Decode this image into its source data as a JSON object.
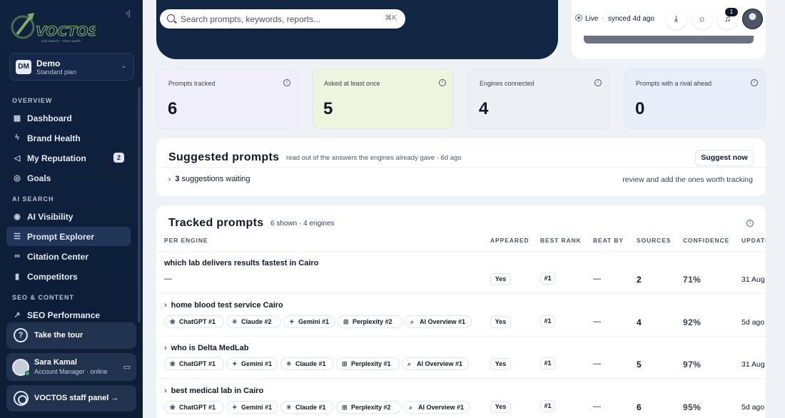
{
  "brand": {
    "name": "VOCTOS",
    "tagline": "one search · more worth"
  },
  "workspace": {
    "initials": "DM",
    "name": "Demo",
    "plan": "Standard plan"
  },
  "sidebar": {
    "sections": {
      "overview": "OVERVIEW",
      "ai_search": "AI SEARCH",
      "seo": "SEO & CONTENT"
    },
    "items": [
      {
        "label": "Dashboard",
        "icon": "grid-icon"
      },
      {
        "label": "Brand Health",
        "icon": "pulse-icon"
      },
      {
        "label": "My Reputation",
        "icon": "megaphone-icon",
        "badge": "2"
      },
      {
        "label": "Goals",
        "icon": "target-icon"
      },
      {
        "label": "AI Visibility",
        "icon": "eye-icon"
      },
      {
        "label": "Prompt Explorer",
        "icon": "list-icon",
        "active": true
      },
      {
        "label": "Citation Center",
        "icon": "link-icon"
      },
      {
        "label": "Competitors",
        "icon": "bar-chart-icon"
      },
      {
        "label": "SEO Performance",
        "icon": "trend-icon"
      }
    ],
    "tour_label": "Take the tour",
    "user": {
      "name": "Sara Kamal",
      "role": "Account Manager · online"
    },
    "staff_label": "VOCTOS staff panel →"
  },
  "topbar": {
    "search_placeholder": "Search prompts, keywords, reports...",
    "search_kbd": "⌘K",
    "live_label": "Live",
    "synced_label": "synced 4d ago",
    "notif_count": "1"
  },
  "stats": [
    {
      "label": "Prompts tracked",
      "value": "6",
      "bg": "#f1eefc"
    },
    {
      "label": "Asked at least once",
      "value": "5",
      "bg": "#eef5df"
    },
    {
      "label": "Engines connected",
      "value": "4",
      "bg": "#eceff4"
    },
    {
      "label": "Prompts with a rival ahead",
      "value": "0",
      "bg": "#e8eef9"
    }
  ],
  "suggested": {
    "title": "Suggested prompts",
    "subtitle": "read out of the answers the engines already gave · 6d ago",
    "button": "Suggest now",
    "count": "3",
    "waiting_label": "suggestions waiting",
    "hint": "review and add the ones worth tracking"
  },
  "tracked": {
    "title": "Tracked prompts",
    "meta": "6 shown · 4 engines",
    "columns": [
      "PER ENGINE",
      "APPEARED",
      "BEST RANK",
      "BEAT BY",
      "SOURCES",
      "CONFIDENCE",
      "UPDATED"
    ],
    "rows": [
      {
        "prompt": "which lab delivers results fastest in Cairo",
        "expandable": false,
        "engines": [],
        "empty_engines": "—",
        "appeared": "Yes",
        "best_rank": "#1",
        "beat_by": "—",
        "sources": "2",
        "confidence": "71%",
        "updated": "31 Aug"
      },
      {
        "prompt": "home blood test service Cairo",
        "expandable": true,
        "engines": [
          {
            "label": "ChatGPT #1",
            "icon": "chatgpt-icon"
          },
          {
            "label": "Claude #2",
            "icon": "claude-icon"
          },
          {
            "label": "Gemini #1",
            "icon": "gemini-icon"
          },
          {
            "label": "Perplexity #2",
            "icon": "perplexity-icon"
          },
          {
            "label": "AI Overview #1",
            "icon": "ai-overview-icon"
          }
        ],
        "appeared": "Yes",
        "best_rank": "#1",
        "beat_by": "—",
        "sources": "4",
        "confidence": "92%",
        "updated": "5d ago"
      },
      {
        "prompt": "who is Delta MedLab",
        "expandable": true,
        "engines": [
          {
            "label": "ChatGPT #1",
            "icon": "chatgpt-icon"
          },
          {
            "label": "Gemini #1",
            "icon": "gemini-icon"
          },
          {
            "label": "Claude #1",
            "icon": "claude-icon"
          },
          {
            "label": "Perplexity #1",
            "icon": "perplexity-icon"
          },
          {
            "label": "AI Overview #1",
            "icon": "ai-overview-icon"
          }
        ],
        "appeared": "Yes",
        "best_rank": "#1",
        "beat_by": "—",
        "sources": "5",
        "confidence": "97%",
        "updated": "31 Aug"
      },
      {
        "prompt": "best medical lab in Cairo",
        "expandable": true,
        "engines": [
          {
            "label": "ChatGPT #1",
            "icon": "chatgpt-icon"
          },
          {
            "label": "Gemini #1",
            "icon": "gemini-icon"
          },
          {
            "label": "Claude #1",
            "icon": "claude-icon"
          },
          {
            "label": "Perplexity #2",
            "icon": "perplexity-icon"
          },
          {
            "label": "AI Overview #1",
            "icon": "ai-overview-icon"
          }
        ],
        "appeared": "Yes",
        "best_rank": "#1",
        "beat_by": "—",
        "sources": "6",
        "confidence": "95%",
        "updated": "5d ago"
      }
    ]
  }
}
